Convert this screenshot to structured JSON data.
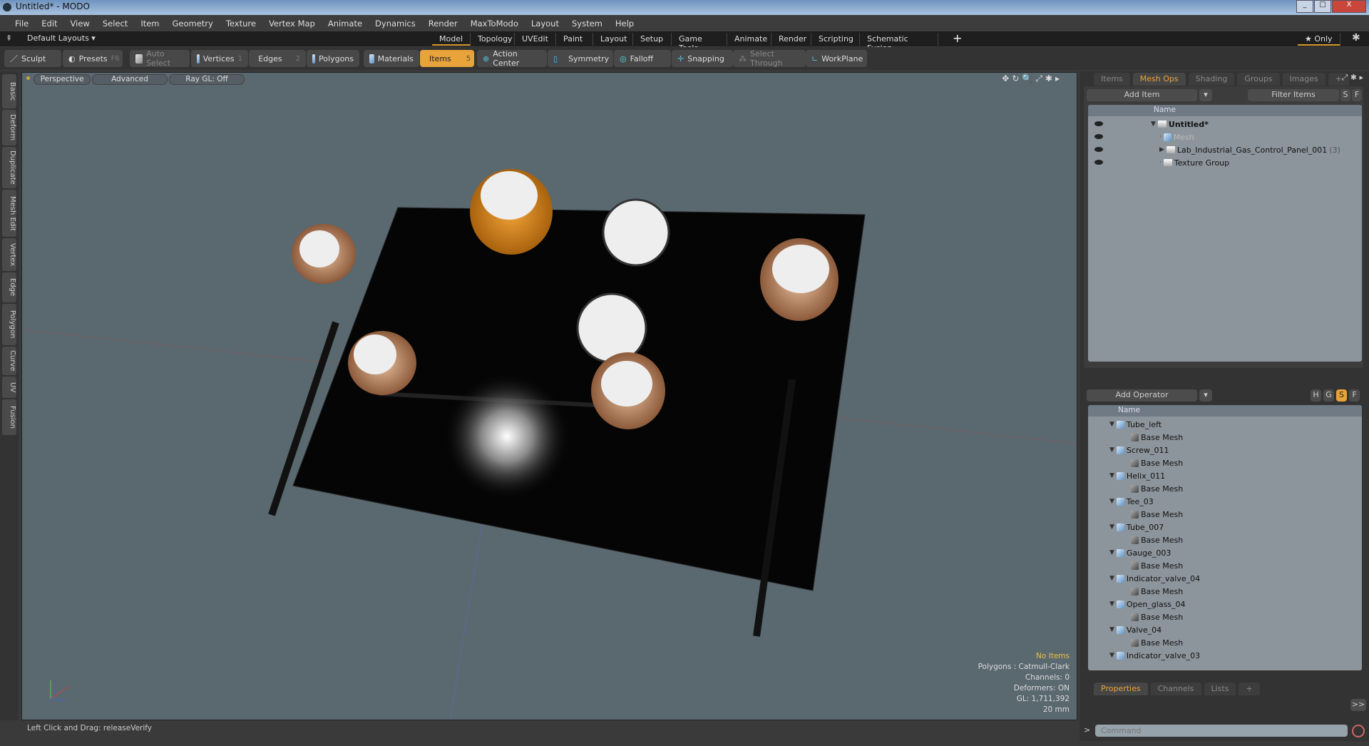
{
  "window": {
    "title": "Untitled* - MODO",
    "controls": [
      "_",
      "□",
      "X"
    ]
  },
  "menu": [
    "File",
    "Edit",
    "View",
    "Select",
    "Item",
    "Geometry",
    "Texture",
    "Vertex Map",
    "Animate",
    "Dynamics",
    "Render",
    "MaxToModo",
    "Layout",
    "System",
    "Help"
  ],
  "layoutbar": {
    "layouts_label": "Default Layouts ▾",
    "tabs": [
      "Model",
      "Topology",
      "UVEdit",
      "Paint",
      "Layout",
      "Setup",
      "Game Tools",
      "Animate",
      "Render",
      "Scripting",
      "Schematic Fusion"
    ],
    "active": "Model",
    "add": "+",
    "only": "★ Only"
  },
  "toolbar": {
    "sculpt": "Sculpt",
    "presets": "Presets",
    "presets_key": "F6",
    "auto_select": "Auto Select",
    "vertices": "Vertices",
    "vertices_key": "1",
    "edges": "Edges",
    "edges_key": "2",
    "polygons": "Polygons",
    "materials": "Materials",
    "items": "Items",
    "items_key": "5",
    "action_center": "Action Center",
    "symmetry": "Symmetry",
    "falloff": "Falloff",
    "snapping": "Snapping",
    "select_through": "Select Through",
    "workplane": "WorkPlane"
  },
  "left_tabs": [
    "Basic",
    "Deform",
    "Duplicate",
    "Mesh Edit",
    "Vertex",
    "Edge",
    "Polygon",
    "Curve",
    "UV",
    "Fusion"
  ],
  "viewport": {
    "view": "Perspective",
    "style": "Advanced",
    "raygl": "Ray GL: Off",
    "hud": {
      "selection": "No Items",
      "polygons": "Polygons : Catmull-Clark",
      "channels": "Channels: 0",
      "deformers": "Deformers: ON",
      "gl": "GL: 1,711,392",
      "scale": "20 mm"
    }
  },
  "status": "Left Click and Drag:   releaseVerify",
  "items_panel": {
    "tabs": [
      "Items",
      "Mesh Ops",
      "Shading",
      "Groups",
      "Images",
      "+"
    ],
    "active": "Mesh Ops",
    "add_item": "Add Item",
    "filter": "Filter Items",
    "s": "S",
    "f": "F",
    "name_header": "Name",
    "tree": [
      {
        "label": "Untitled*",
        "bold": true
      },
      {
        "label": "Mesh",
        "dim": true
      },
      {
        "label": "Lab_Industrial_Gas_Control_Panel_001",
        "count": "(3)"
      },
      {
        "label": "Texture Group"
      }
    ]
  },
  "meshops_panel": {
    "add_operator": "Add Operator",
    "flags": [
      "H",
      "G",
      "S",
      "F"
    ],
    "name_header": "Name",
    "rows": [
      {
        "label": "Tube_left",
        "level": 0
      },
      {
        "label": "Base Mesh",
        "level": 1
      },
      {
        "label": "Screw_011",
        "level": 0
      },
      {
        "label": "Base Mesh",
        "level": 1
      },
      {
        "label": "Helix_011",
        "level": 0
      },
      {
        "label": "Base Mesh",
        "level": 1
      },
      {
        "label": "Tee_03",
        "level": 0
      },
      {
        "label": "Base Mesh",
        "level": 1
      },
      {
        "label": "Tube_007",
        "level": 0
      },
      {
        "label": "Base Mesh",
        "level": 1
      },
      {
        "label": "Gauge_003",
        "level": 0
      },
      {
        "label": "Base Mesh",
        "level": 1
      },
      {
        "label": "Indicator_valve_04",
        "level": 0
      },
      {
        "label": "Base Mesh",
        "level": 1
      },
      {
        "label": "Open_glass_04",
        "level": 0
      },
      {
        "label": "Base Mesh",
        "level": 1
      },
      {
        "label": "Valve_04",
        "level": 0
      },
      {
        "label": "Base Mesh",
        "level": 1
      },
      {
        "label": "Indicator_valve_03",
        "level": 0
      }
    ]
  },
  "properties_panel": {
    "tabs": [
      "Properties",
      "Channels",
      "Lists",
      "+"
    ],
    "active": "Properties",
    "expand": ">>"
  },
  "command": {
    "prompt": ">",
    "placeholder": "Command"
  },
  "colors": {
    "accent": "#e8a33a",
    "viewport": "#5a6870"
  }
}
